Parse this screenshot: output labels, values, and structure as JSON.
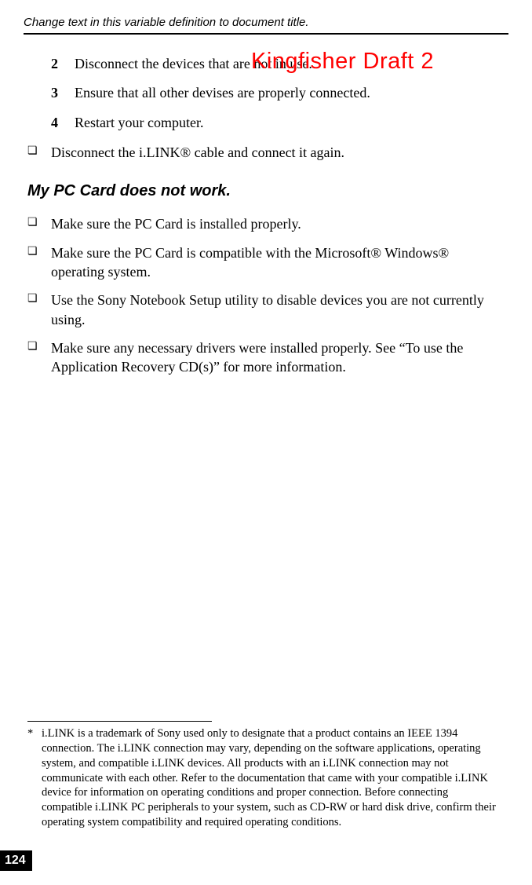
{
  "header": {
    "title": "Change text in this variable definition to document title."
  },
  "draft_label": "Kingfisher Draft 2",
  "steps": [
    {
      "num": "2",
      "text": "Disconnect the devices that are not in use."
    },
    {
      "num": "3",
      "text": "Ensure that all other devises are properly connected."
    },
    {
      "num": "4",
      "text": "Restart your computer."
    }
  ],
  "bullets_top": [
    "Disconnect the i.LINK® cable and connect it again."
  ],
  "section_heading": "My PC Card does not work.",
  "bullets_section": [
    "Make sure the PC Card is installed properly.",
    "Make sure the PC Card is compatible with the Microsoft® Windows® operating system.",
    "Use the Sony Notebook Setup utility to disable devices you are not currently using.",
    "Make sure any necessary drivers were installed properly. See “To use the Application Recovery CD(s)” for more information."
  ],
  "footnote": {
    "mark": "*",
    "text": "i.LINK is a trademark of Sony used only to designate that a product contains an IEEE 1394 connection. The i.LINK connection may vary, depending on the software applications, operating system, and compatible i.LINK devices. All products with an i.LINK connection may not communicate with each other. Refer to the documentation that came with your compatible i.LINK device for information on operating conditions and proper connection. Before connecting compatible i.LINK PC peripherals to your system, such as CD-RW or hard disk drive, confirm their operating system compatibility and required operating conditions."
  },
  "page_number": "124"
}
